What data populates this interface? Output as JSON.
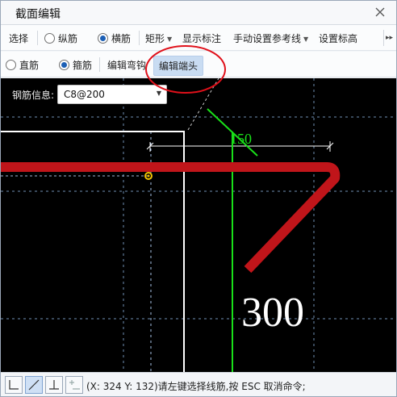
{
  "window": {
    "title": "截面编辑"
  },
  "toolbar1": {
    "select": "选择",
    "longitudinal": "纵筋",
    "transverse": "横筋",
    "rectangle": "矩形",
    "show_annotation": "显示标注",
    "manual_ref_line": "手动设置参考线",
    "set_elevation": "设置标高"
  },
  "toolbar2": {
    "straight": "直筋",
    "stirrup": "箍筋",
    "edit_hook": "编辑弯钩",
    "edit_end": "编辑端头"
  },
  "rebar": {
    "label": "钢筋信息:",
    "value": "C8@200"
  },
  "canvas": {
    "dimension_small": "150",
    "dimension_large": "300",
    "colors": {
      "background": "#000000",
      "rebar": "#c0151a",
      "axis": "#19e019",
      "outline": "#ffffff",
      "dashed": "#6f8fb5",
      "highlight_circle": "#e0101a"
    }
  },
  "status": {
    "text": "(X: 324 Y: 132)请左键选择线筋,按 ESC 取消命令;"
  },
  "icons": {
    "close": "close-icon",
    "more": "more-arrows-icon",
    "snap_orthogonal": "ortho-icon",
    "snap_angle": "angle-icon",
    "snap_perp": "perpendicular-icon",
    "snap_grid": "grid-snap-icon"
  }
}
